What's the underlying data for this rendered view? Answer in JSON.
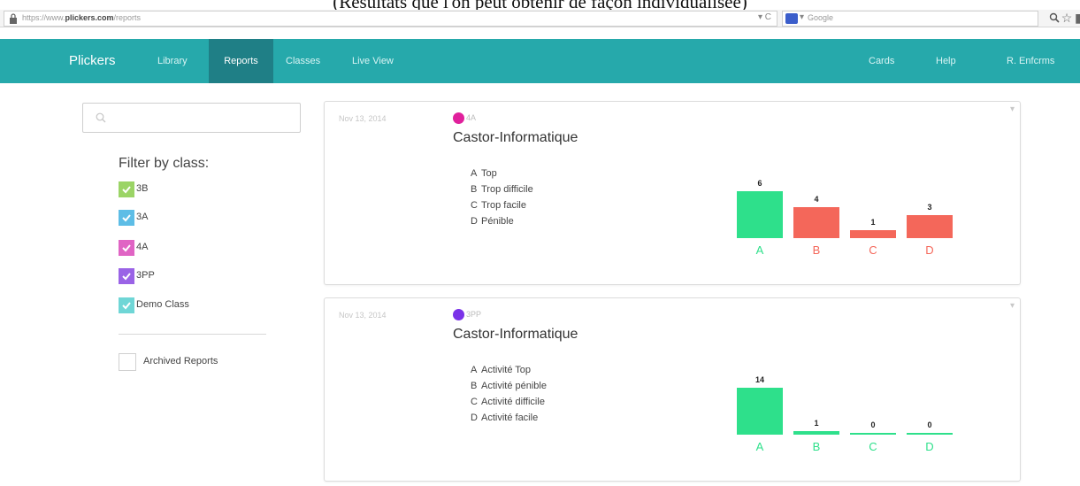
{
  "page_caption": "(Résultats que l'on peut obtenir de façon individualisée)",
  "browser": {
    "url_prefix": "https://www.",
    "url_domain": "plickers.com",
    "url_path": "/reports",
    "url_controls": "▾ C",
    "search_placeholder": "Google",
    "search_engine_arrow": "▾",
    "icons": [
      "lock-icon",
      "search-icon",
      "star-icon",
      "menu-icon"
    ]
  },
  "nav": {
    "brand": "Plickers",
    "items": [
      {
        "label": "Library",
        "active": false
      },
      {
        "label": "Reports",
        "active": true
      },
      {
        "label": "Classes",
        "active": false
      },
      {
        "label": "Live View",
        "active": false
      }
    ],
    "right_items": [
      "Cards",
      "Help",
      "R. Enfcrms"
    ],
    "color": "#26a9ab",
    "active_color": "#1f7f86"
  },
  "sidebar": {
    "search_placeholder": "",
    "filter_title": "Filter by class:",
    "classes": [
      {
        "label": "3B",
        "color": "#9bd466",
        "checked": true
      },
      {
        "label": "3A",
        "color": "#5dbde6",
        "checked": true
      },
      {
        "label": "4A",
        "color": "#e064c4",
        "checked": true
      },
      {
        "label": "3PP",
        "color": "#9a63e6",
        "checked": true
      },
      {
        "label": "Demo Class",
        "color": "#6fd6d6",
        "checked": true
      }
    ],
    "archived_label": "Archived Reports",
    "archived_checked": false
  },
  "reports": [
    {
      "date": "Nov 13, 2014",
      "class_name": "4A",
      "class_color": "#e0209c",
      "title": "Castor-Informatique",
      "answers": [
        {
          "key": "A",
          "text": "Top"
        },
        {
          "key": "B",
          "text": "Trop difficile"
        },
        {
          "key": "C",
          "text": "Trop facile"
        },
        {
          "key": "D",
          "text": "Pénible"
        }
      ],
      "chart_data": {
        "type": "bar",
        "categories": [
          "A",
          "B",
          "C",
          "D"
        ],
        "values": [
          6,
          4,
          1,
          3
        ],
        "colors": [
          "#2ee08b",
          "#f4675a",
          "#f4675a",
          "#f4675a"
        ]
      }
    },
    {
      "date": "Nov 13, 2014",
      "class_name": "3PP",
      "class_color": "#7a32e8",
      "title": "Castor-Informatique",
      "answers": [
        {
          "key": "A",
          "text": "Activité Top"
        },
        {
          "key": "B",
          "text": "Activité pénible"
        },
        {
          "key": "C",
          "text": "Activité difficile"
        },
        {
          "key": "D",
          "text": "Activité facile"
        }
      ],
      "chart_data": {
        "type": "bar",
        "categories": [
          "A",
          "B",
          "C",
          "D"
        ],
        "values": [
          14,
          1,
          0,
          0
        ],
        "colors": [
          "#2ee08b",
          "#2ee08b",
          "#2ee08b",
          "#2ee08b"
        ]
      }
    }
  ]
}
